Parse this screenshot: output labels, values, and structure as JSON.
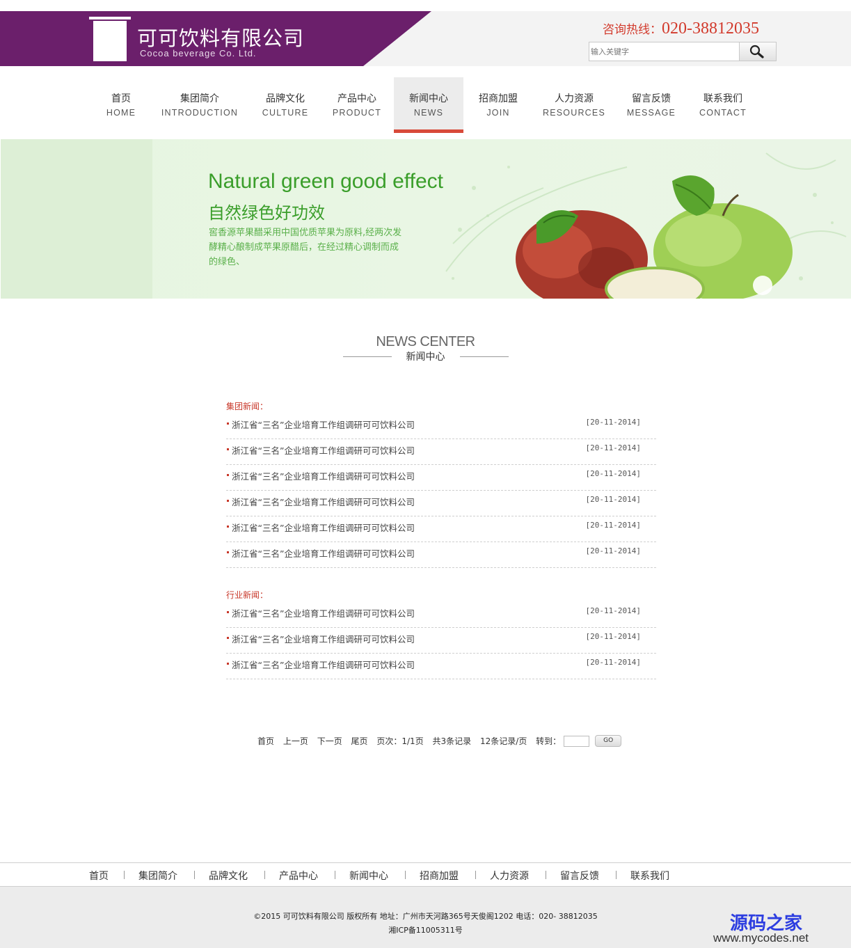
{
  "header": {
    "company_name": "可可饮料有限公司",
    "company_en": "Cocoa beverage Co. Ltd.",
    "hotline_label": "咨询热线：",
    "hotline_number": "020-38812035",
    "search_placeholder": "输入关键字",
    "search_icon": "magnifier-icon",
    "brand_color": "#6b1f6b",
    "accent_color": "#d23a2c"
  },
  "nav": {
    "items": [
      {
        "cn": "首页",
        "en": "HOME"
      },
      {
        "cn": "集团简介",
        "en": "INTRODUCTION"
      },
      {
        "cn": "品牌文化",
        "en": "CULTURE"
      },
      {
        "cn": "产品中心",
        "en": "PRODUCT"
      },
      {
        "cn": "新闻中心",
        "en": "NEWS"
      },
      {
        "cn": "招商加盟",
        "en": "JOIN"
      },
      {
        "cn": "人力资源",
        "en": "RESOURCES"
      },
      {
        "cn": "留言反馈",
        "en": "MESSAGE"
      },
      {
        "cn": "联系我们",
        "en": "CONTACT"
      }
    ],
    "active": "新闻中心"
  },
  "banner": {
    "title_en": "Natural green good effect",
    "title_cn": "自然绿色好功效",
    "description": "窖香源苹果醋采用中国优质苹果为原料,经两次发酵精心酿制成苹果原醋后，在经过精心调制而成的绿色、"
  },
  "news_center": {
    "title_en": "NEWS CENTER",
    "title_cn": "新闻中心"
  },
  "group_news": {
    "label": "集团新闻：",
    "items": [
      {
        "title": "浙江省“三名”企业培育工作组调研可可饮料公司",
        "date": "[20-11-2014]"
      },
      {
        "title": "浙江省“三名”企业培育工作组调研可可饮料公司",
        "date": "[20-11-2014]"
      },
      {
        "title": "浙江省“三名”企业培育工作组调研可可饮料公司",
        "date": "[20-11-2014]"
      },
      {
        "title": "浙江省“三名”企业培育工作组调研可可饮料公司",
        "date": "[20-11-2014]"
      },
      {
        "title": "浙江省“三名”企业培育工作组调研可可饮料公司",
        "date": "[20-11-2014]"
      },
      {
        "title": "浙江省“三名”企业培育工作组调研可可饮料公司",
        "date": "[20-11-2014]"
      }
    ]
  },
  "industry_news": {
    "label": "行业新闻：",
    "items": [
      {
        "title": "浙江省“三名”企业培育工作组调研可可饮料公司",
        "date": "[20-11-2014]"
      },
      {
        "title": "浙江省“三名”企业培育工作组调研可可饮料公司",
        "date": "[20-11-2014]"
      },
      {
        "title": "浙江省“三名”企业培育工作组调研可可饮料公司",
        "date": "[20-11-2014]"
      }
    ]
  },
  "pager": {
    "first": "首页",
    "prev": "上一页",
    "next": "下一页",
    "last": "尾页",
    "pages": "页次：1/1页",
    "total": "共3条记录",
    "per_page": "12条记录/页",
    "goto_label": "转到：",
    "go": "GO"
  },
  "footer_nav": [
    "首页",
    "集团简介",
    "品牌文化",
    "产品中心",
    "新闻中心",
    "招商加盟",
    "人力资源",
    "留言反馈",
    "联系我们"
  ],
  "footer": {
    "copyright": "©2015 可可饮料有限公司 版权所有 地址：广州市天河路365号天俊阁1202 电话：020- 38812035",
    "icp": "湘ICP备11005311号",
    "watermark_cn": "源码之家",
    "watermark_en": "www.mycodes.net"
  }
}
